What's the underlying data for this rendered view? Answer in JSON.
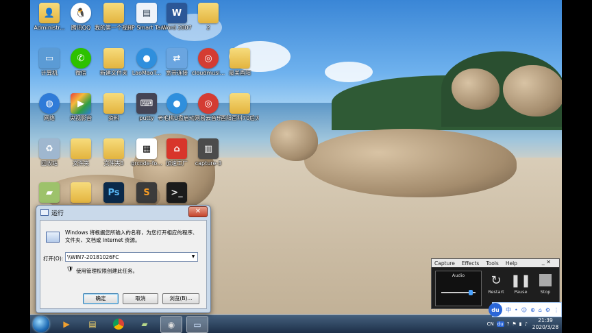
{
  "desktop": {
    "icons": [
      {
        "label": "Administr...",
        "icon": "folder-user-icon",
        "col": 0,
        "row": 0
      },
      {
        "label": "腾讯QQ",
        "icon": "qq-penguin-icon",
        "col": 1,
        "row": 0
      },
      {
        "label": "我的第一个视频",
        "icon": "folder-icon",
        "col": 2,
        "row": 0
      },
      {
        "label": "HP Smart Tank 518...",
        "icon": "printer-doc-icon",
        "col": 3,
        "row": 0
      },
      {
        "label": "Word 2007",
        "icon": "word-icon",
        "col": 4,
        "row": 0
      },
      {
        "label": "2",
        "icon": "folder-icon",
        "col": 5,
        "row": 0
      },
      {
        "label": "计算机",
        "icon": "computer-icon",
        "col": 0,
        "row": 1
      },
      {
        "label": "微信",
        "icon": "wechat-icon",
        "col": 1,
        "row": 1
      },
      {
        "label": "新建文件夹",
        "icon": "folder-icon",
        "col": 2,
        "row": 1
      },
      {
        "label": "LaoMaoT...",
        "icon": "laomao-icon",
        "col": 3,
        "row": 1
      },
      {
        "label": "宽带连接",
        "icon": "network-connection-icon",
        "col": 4,
        "row": 1
      },
      {
        "label": "cloudmusi...",
        "icon": "netease-music-icon",
        "col": 5,
        "row": 1
      },
      {
        "label": "最美酉阳",
        "icon": "folder-icon",
        "col": 6,
        "row": 1
      },
      {
        "label": "网络",
        "icon": "network-globe-icon",
        "col": 0,
        "row": 2
      },
      {
        "label": "央视影音",
        "icon": "cctv-video-icon",
        "col": 1,
        "row": 2
      },
      {
        "label": "资料",
        "icon": "folder-icon",
        "col": 2,
        "row": 2
      },
      {
        "label": "putty",
        "icon": "putty-icon",
        "col": 3,
        "row": 2
      },
      {
        "label": "老毛桃U盘启动版",
        "icon": "laomao-icon",
        "col": 4,
        "row": 2
      },
      {
        "label": "网易云音乐",
        "icon": "netease-music-icon",
        "col": 5,
        "row": 2
      },
      {
        "label": "酉阳百科70后大数...",
        "icon": "folder-icon",
        "col": 6,
        "row": 2
      },
      {
        "label": "回收站",
        "icon": "recycle-bin-icon",
        "col": 0,
        "row": 3
      },
      {
        "label": "文件夹",
        "icon": "folder-icon",
        "col": 1,
        "row": 3
      },
      {
        "label": "文件夹3",
        "icon": "folder-icon",
        "col": 2,
        "row": 3
      },
      {
        "label": "qrcode-fo...",
        "icon": "qrcode-icon",
        "col": 3,
        "row": 3
      },
      {
        "label": "加速工厂",
        "icon": "red-house-icon",
        "col": 4,
        "row": 3
      },
      {
        "label": "capture-3",
        "icon": "video-file-icon",
        "col": 5,
        "row": 3
      },
      {
        "label": "",
        "icon": "image-file-icon",
        "col": 0,
        "row": 4
      },
      {
        "label": "",
        "icon": "folder-icon",
        "col": 1,
        "row": 4
      },
      {
        "label": "",
        "icon": "photoshop-icon",
        "col": 2,
        "row": 4
      },
      {
        "label": "",
        "icon": "sublime-icon",
        "col": 3,
        "row": 4
      },
      {
        "label": "",
        "icon": "terminal-icon",
        "col": 4,
        "row": 4
      }
    ]
  },
  "run_dialog": {
    "title": "运行",
    "close": "✕",
    "description": "Windows 将根据您所输入的名称，为您打开相应的程序、文件夹、文档或 Internet 资源。",
    "open_label": "打开(O):",
    "open_value": "\\\\WIN7-20181026FC",
    "admin_note": "使用管理权限创建此任务。",
    "ok": "确定",
    "cancel": "取消",
    "browse": "浏览(B)..."
  },
  "capture_tool": {
    "menu": [
      "Capture",
      "Effects",
      "Tools",
      "Help"
    ],
    "window_controls": "_ ✕",
    "audio_label": "Audio",
    "audio_level": 0.9,
    "restart": "Restart",
    "pause": "Pause",
    "stop": "Stop"
  },
  "baidu_bar": {
    "logo": "du",
    "items": [
      "中",
      "•",
      "☺",
      "⊕",
      "⌂",
      "⚙",
      "⋮"
    ]
  },
  "taskbar": {
    "tray_icons": [
      "CN",
      "du",
      "?",
      "⚑",
      "▮",
      "♪"
    ],
    "time": "21:39",
    "date": "2020/3/28"
  }
}
